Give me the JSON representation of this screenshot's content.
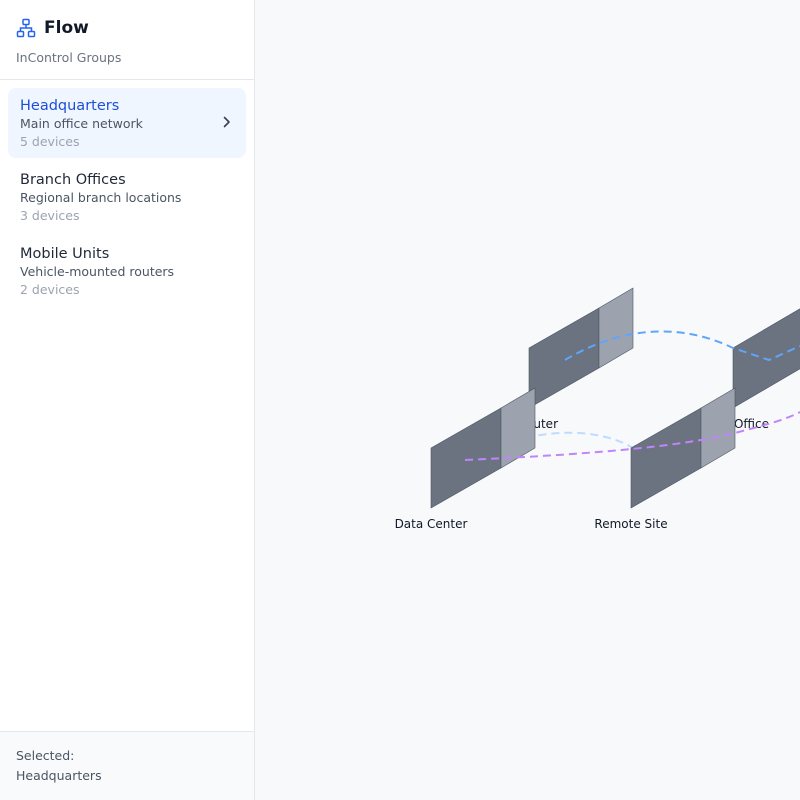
{
  "app": {
    "title": "Flow",
    "subtitle": "InControl Groups"
  },
  "groups": [
    {
      "name": "Headquarters",
      "description": "Main office network",
      "count": "5 devices",
      "active": true
    },
    {
      "name": "Branch Offices",
      "description": "Regional branch locations",
      "count": "3 devices",
      "active": false
    },
    {
      "name": "Mobile Units",
      "description": "Vehicle-mounted routers",
      "count": "2 devices",
      "active": false
    }
  ],
  "footer": {
    "label": "Selected:",
    "value": "Headquarters"
  },
  "diagram": {
    "nodes": {
      "router": "outer",
      "office": "Office",
      "data_center": "Data Center",
      "remote_site": "Remote Site"
    }
  },
  "colors": {
    "accent": "#1d4ed8",
    "active_bg": "#eff6ff",
    "link_blue": "#60a5fa",
    "link_light_blue": "#bfdbfe",
    "link_purple": "#c084fc",
    "node_front": "#6b7280",
    "node_side": "#9ca3af"
  },
  "icons": {
    "brand": "network-hierarchy-icon",
    "chevron": "chevron-right-icon"
  }
}
